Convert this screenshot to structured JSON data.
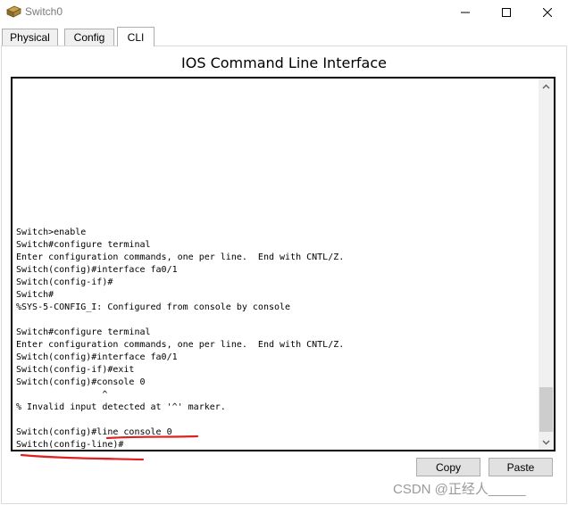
{
  "window": {
    "title": "Switch0",
    "icon": "switch-device-icon",
    "controls": [
      "minimize-icon",
      "maximize-icon",
      "close-icon"
    ]
  },
  "tabs": [
    {
      "label": "Physical",
      "selected": false
    },
    {
      "label": "Config",
      "selected": false
    },
    {
      "label": "CLI",
      "selected": true
    }
  ],
  "cli": {
    "heading": "IOS Command Line Interface",
    "output": "Switch>enable\nSwitch#configure terminal\nEnter configuration commands, one per line.  End with CNTL/Z.\nSwitch(config)#interface fa0/1\nSwitch(config-if)#\nSwitch#\n%SYS-5-CONFIG_I: Configured from console by console\n\nSwitch#configure terminal\nEnter configuration commands, one per line.  End with CNTL/Z.\nSwitch(config)#interface fa0/1\nSwitch(config-if)#exit\nSwitch(config)#console 0\n                ^\n% Invalid input detected at '^' marker.\n\nSwitch(config)#line console 0\nSwitch(config-line)#",
    "annotation_color": "#e02020"
  },
  "buttons": {
    "copy": "Copy",
    "paste": "Paste"
  },
  "watermark": "CSDN @正经人_____"
}
